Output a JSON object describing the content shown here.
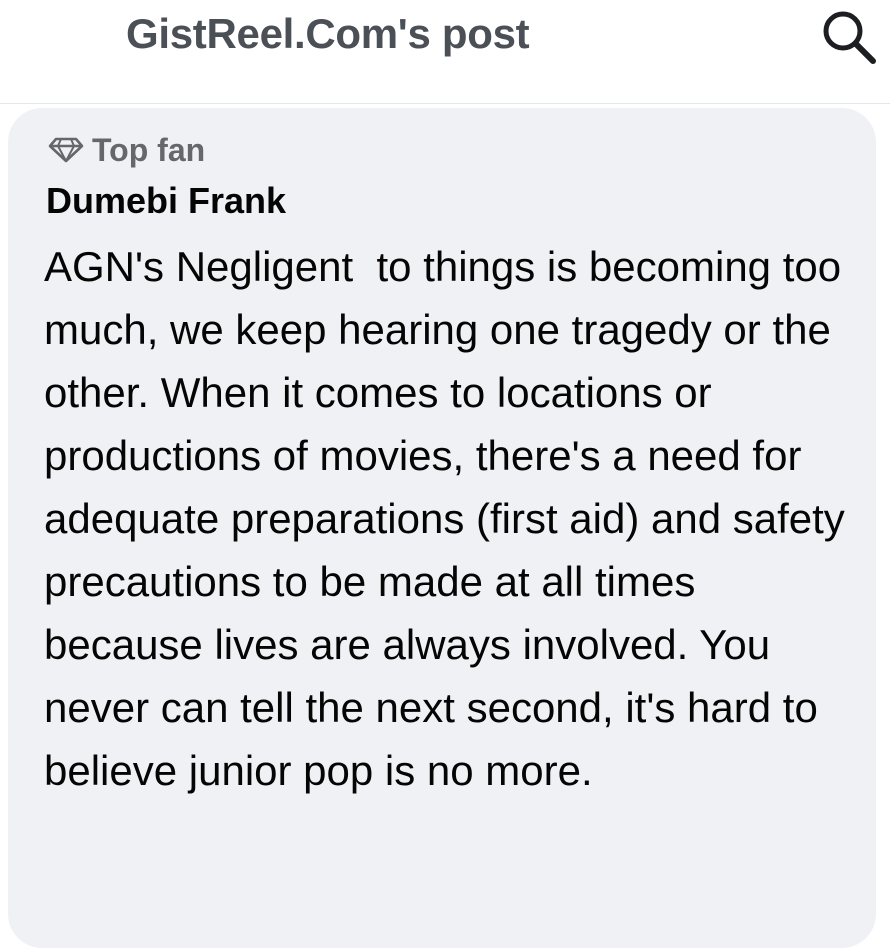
{
  "header": {
    "title": "GistReel.Com's post",
    "search_icon": "search-icon"
  },
  "comment": {
    "badge_icon": "diamond-icon",
    "badge_label": "Top fan",
    "author": "Dumebi Frank",
    "text": "AGN's Negligent  to things is becoming too much, we keep hearing one tragedy or the other. When it comes to locations or productions of movies, there's a need for adequate preparations (first aid) and safety precautions to be made at all times because lives are always involved. You never can tell the next second, it's hard to believe junior pop is no more."
  },
  "colors": {
    "header_text": "#4b4f56",
    "bubble_bg": "#f0f1f4",
    "secondary_text": "#65676b",
    "primary_text": "#050505"
  }
}
